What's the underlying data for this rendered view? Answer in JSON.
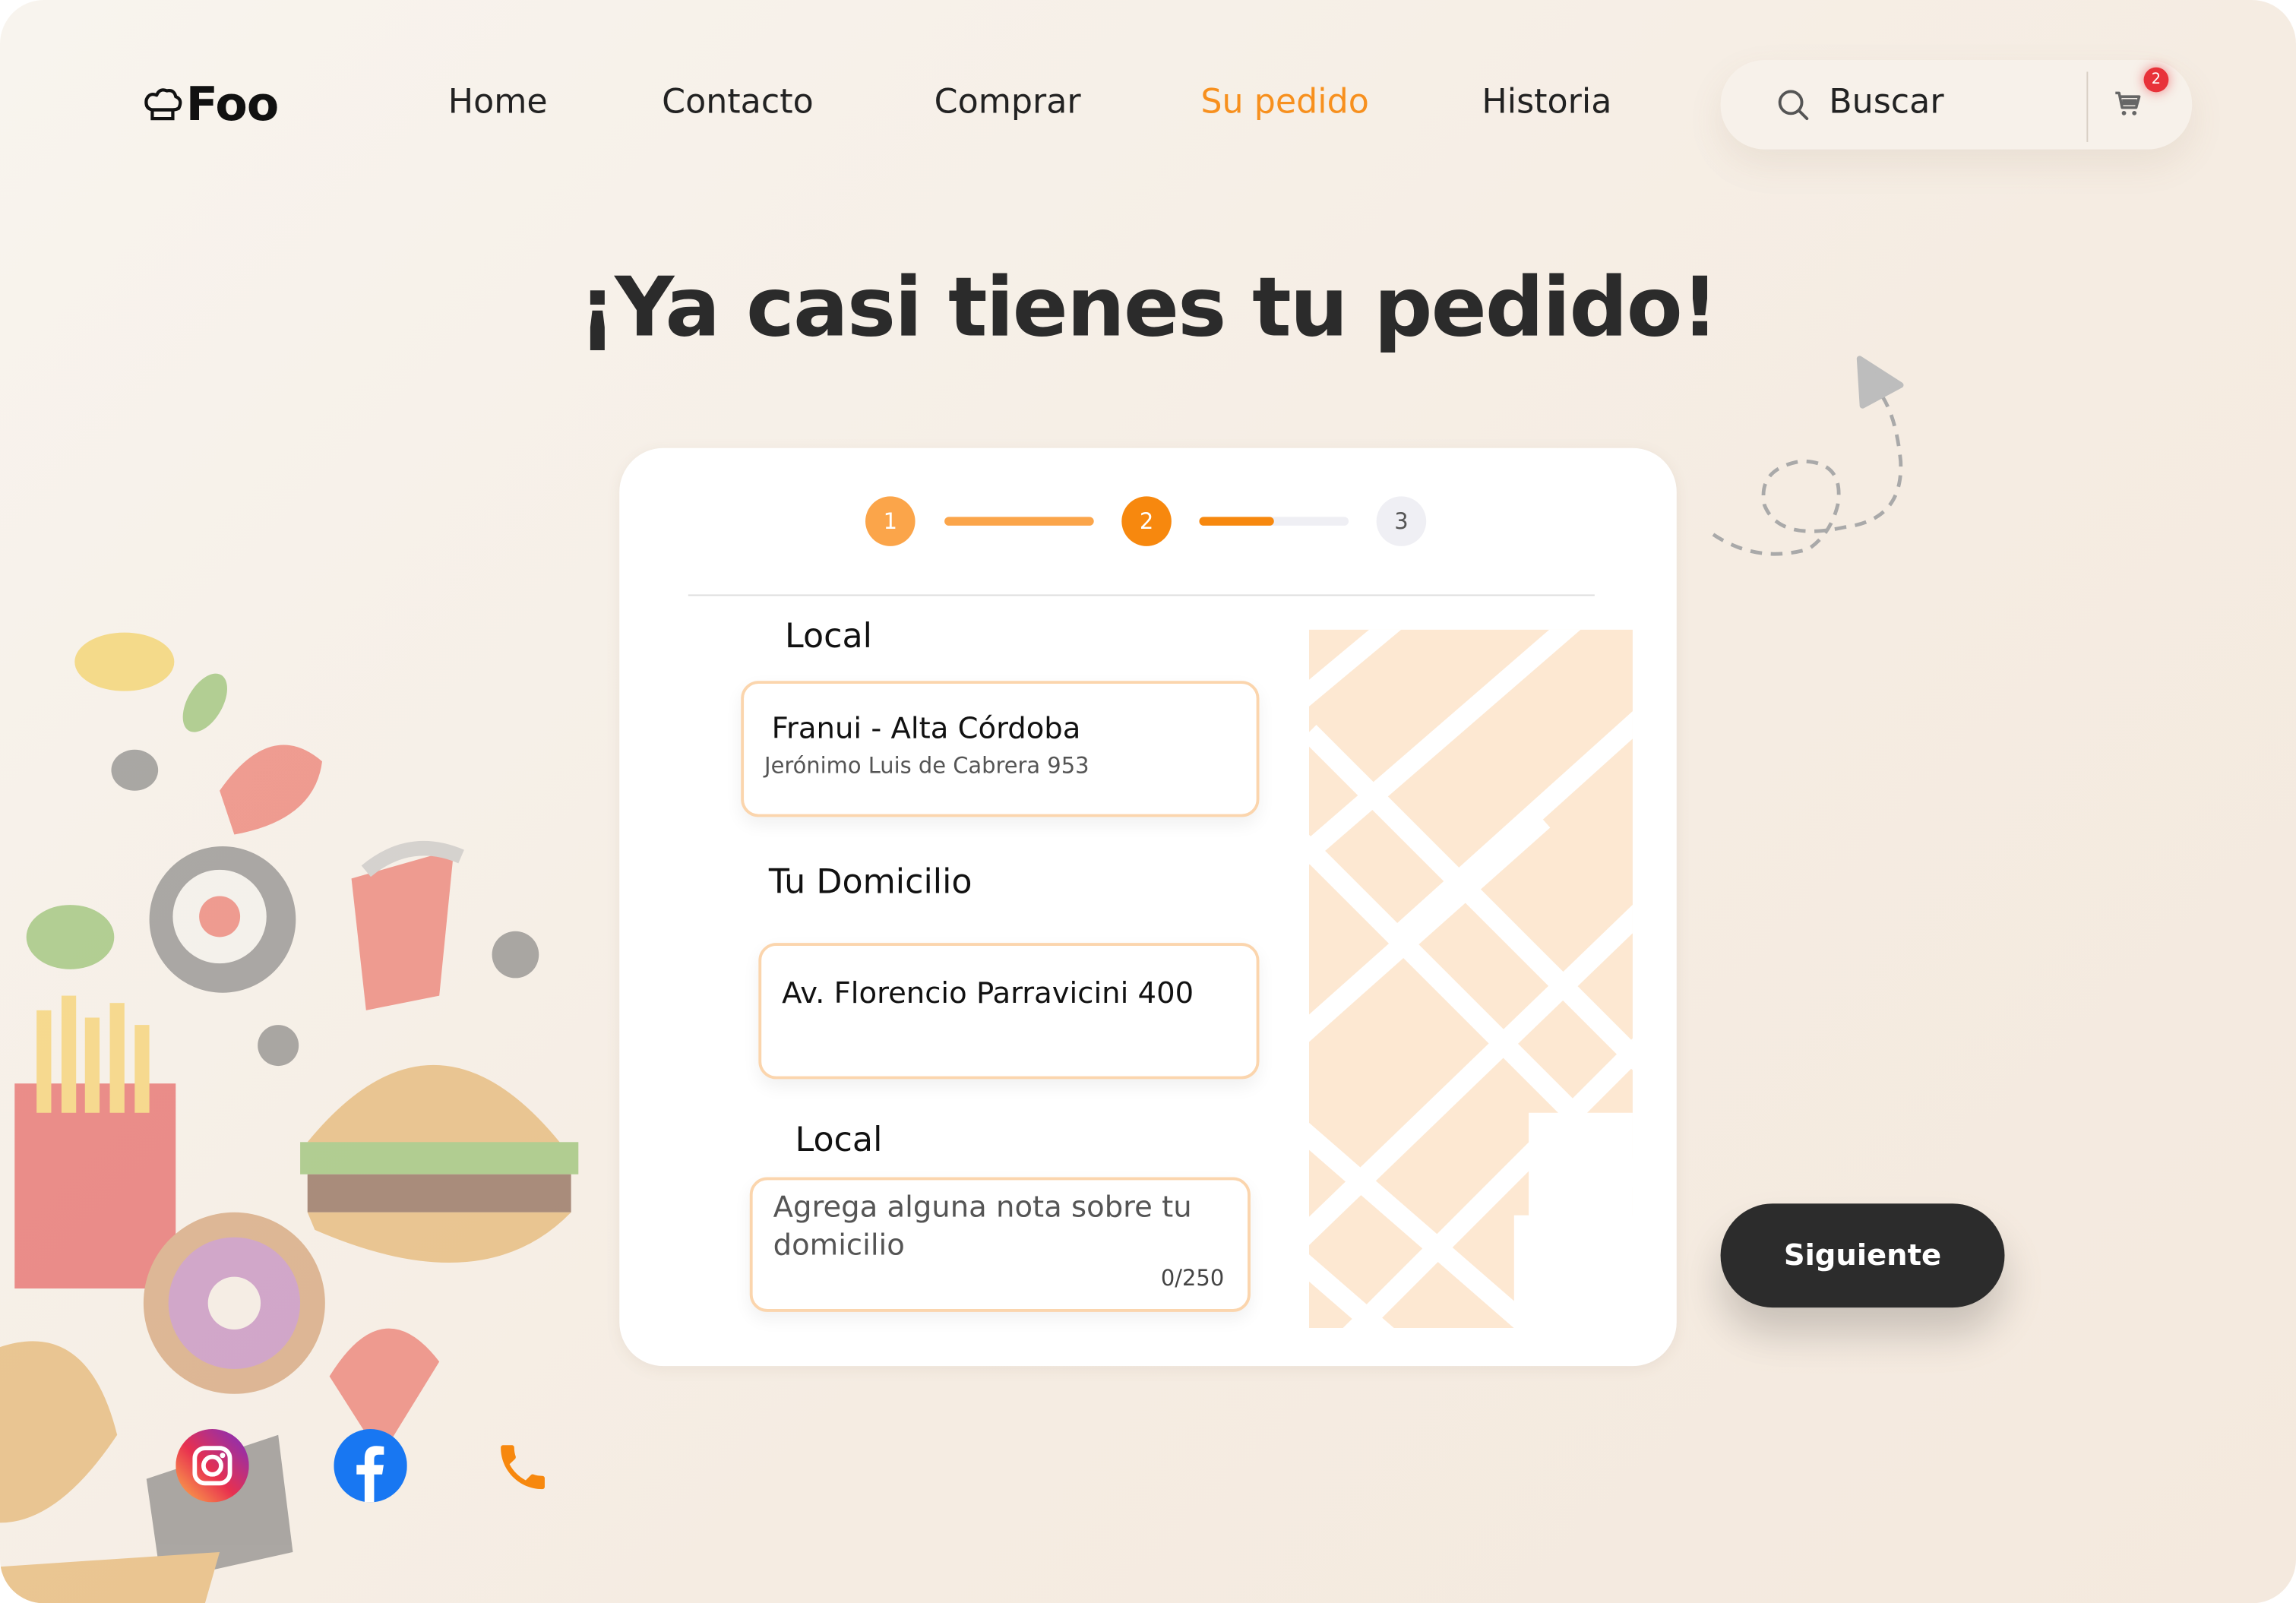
{
  "brand": {
    "logo_text": "Foo",
    "logo_icon": "chef-hat-icon"
  },
  "nav": {
    "items": [
      "Home",
      "Contacto",
      "Comprar",
      "Su pedido",
      "Historia"
    ],
    "active": "Su pedido"
  },
  "search": {
    "placeholder": "Buscar",
    "icon": "search-icon"
  },
  "cart": {
    "icon": "cart-icon",
    "badge_count": "2"
  },
  "headline": "¡Ya casi tienes tu pedido!",
  "stepper": {
    "steps": [
      "1",
      "2",
      "3"
    ],
    "current_step": 2,
    "progress_1_2": 1.0,
    "progress_2_3": 0.5
  },
  "form": {
    "pickup_label": "Local",
    "pickup_name": "Franui - Alta Córdoba",
    "pickup_address": "Jerónimo Luis de Cabrera 953",
    "home_label": "Tu Domicilio",
    "home_address": "Av. Florencio Parravicini 400",
    "note_label": "Local",
    "note_placeholder": "Agrega alguna nota sobre tu domicilio",
    "note_counter": "0/250"
  },
  "actions": {
    "next_label": "Siguiente"
  },
  "social": {
    "icons": [
      "instagram-icon",
      "facebook-icon",
      "phone-icon"
    ]
  },
  "colors": {
    "accent": "#f7901e",
    "step_done": "#fba54a",
    "dark_button": "#2c2c2c",
    "map_block": "#fde8d2",
    "badge": "#e8323a"
  }
}
